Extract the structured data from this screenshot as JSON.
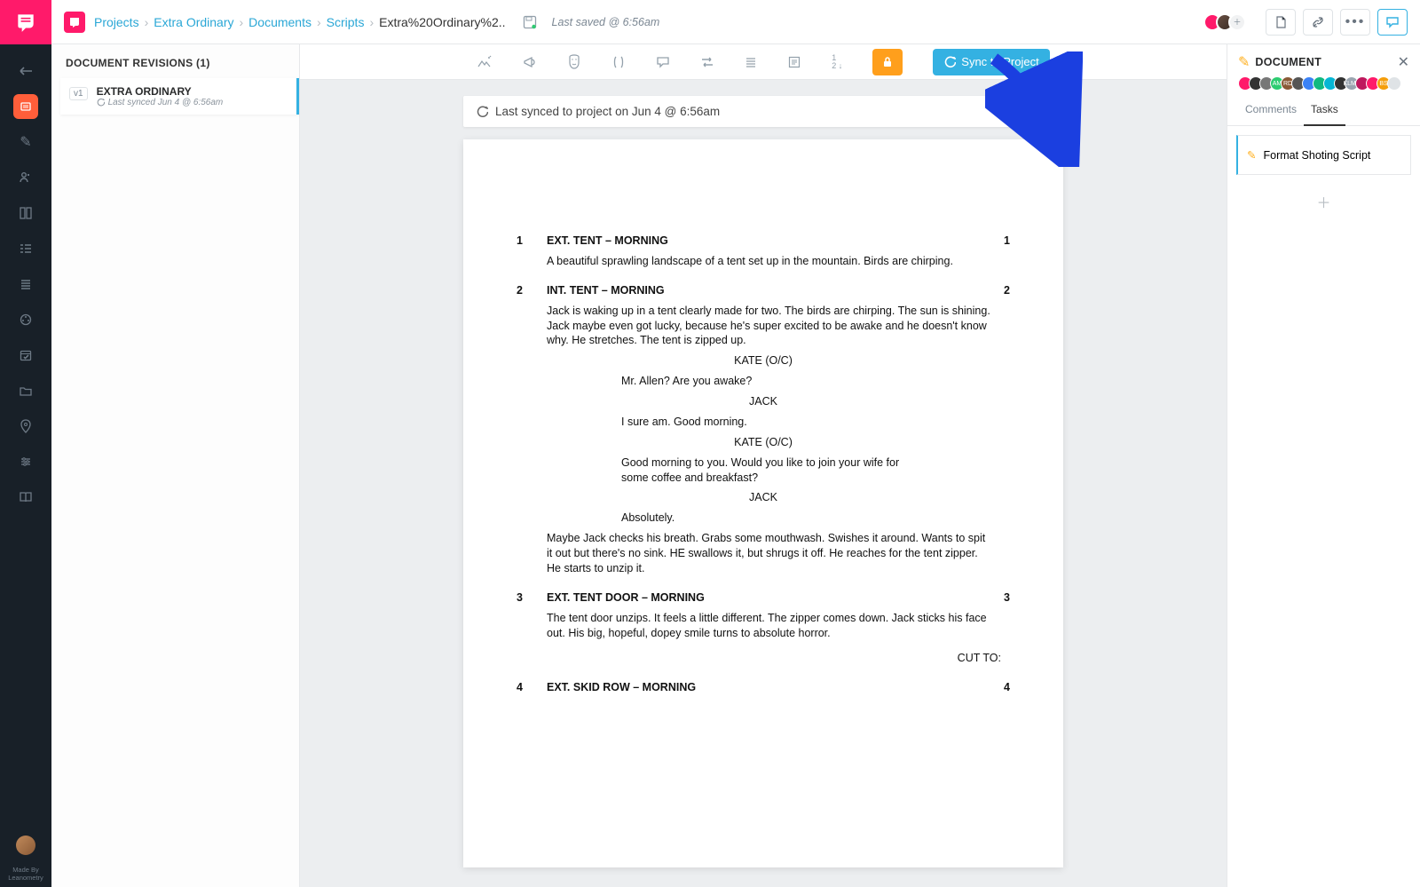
{
  "breadcrumbs": {
    "projects": "Projects",
    "project": "Extra Ordinary",
    "documents": "Documents",
    "scripts": "Scripts",
    "current": "Extra%20Ordinary%2.."
  },
  "topbar": {
    "last_saved": "Last saved @ 6:56am"
  },
  "revisions": {
    "heading": "DOCUMENT REVISIONS (1)",
    "items": [
      {
        "version": "v1",
        "title": "EXTRA ORDINARY",
        "meta": "Last synced Jun 4 @ 6:56am"
      }
    ]
  },
  "toolbar": {
    "sync_label": "Sync to Project"
  },
  "syncbar": {
    "text": "Last synced to project on Jun 4 @ 6:56am"
  },
  "script": {
    "scenes": [
      {
        "num": "1",
        "heading": "EXT. TENT – MORNING",
        "blocks": [
          {
            "type": "action",
            "text": "A beautiful sprawling landscape of a tent set up in the mountain. Birds are chirping."
          }
        ]
      },
      {
        "num": "2",
        "heading": "INT. TENT – MORNING",
        "blocks": [
          {
            "type": "action",
            "text": "Jack is waking up in a tent clearly made for two. The birds are chirping. The sun is shining. Jack maybe even got lucky, because he's super excited to be awake and he doesn't know why. He stretches. The tent is zipped up."
          },
          {
            "type": "cue",
            "text": "KATE (O/C)"
          },
          {
            "type": "line",
            "text": "Mr. Allen? Are you awake?"
          },
          {
            "type": "cue",
            "text": "JACK"
          },
          {
            "type": "line",
            "text": "I sure am. Good morning."
          },
          {
            "type": "cue",
            "text": "KATE (O/C)"
          },
          {
            "type": "line",
            "text": "Good morning to you. Would you like to join your wife for some coffee and breakfast?"
          },
          {
            "type": "cue",
            "text": "JACK"
          },
          {
            "type": "line",
            "text": "Absolutely."
          },
          {
            "type": "action",
            "text": "Maybe Jack checks his breath. Grabs some mouthwash. Swishes it around. Wants to spit it out but there's no sink. HE swallows it, but shrugs it off. He reaches for the tent zipper. He starts to unzip it."
          }
        ]
      },
      {
        "num": "3",
        "heading": "EXT. TENT DOOR – MORNING",
        "blocks": [
          {
            "type": "action",
            "text": "The tent door unzips. It feels a little different. The zipper comes down. Jack sticks his face out. His big, hopeful, dopey smile turns to absolute horror."
          },
          {
            "type": "transition",
            "text": "CUT TO:"
          }
        ]
      },
      {
        "num": "4",
        "heading": "EXT. SKID ROW – MORNING",
        "blocks": []
      }
    ]
  },
  "side": {
    "title": "DOCUMENT",
    "tabs": {
      "comments": "Comments",
      "tasks": "Tasks"
    },
    "task_input": "Format Shoting Script"
  },
  "footer": {
    "made_by": "Made By",
    "leanometry": "Leanometry"
  },
  "avatars": {
    "top": [
      "#ff1a6a",
      "#6a5043",
      "#dfe3e6"
    ],
    "side": [
      {
        "c": "#ff1a6a",
        "t": ""
      },
      {
        "c": "#333",
        "t": ""
      },
      {
        "c": "#777",
        "t": ""
      },
      {
        "c": "#2ecc71",
        "t": "AM"
      },
      {
        "c": "#8a5a36",
        "t": "RD"
      },
      {
        "c": "#555",
        "t": ""
      },
      {
        "c": "#3b82f6",
        "t": ""
      },
      {
        "c": "#10b981",
        "t": ""
      },
      {
        "c": "#06b6d4",
        "t": ""
      },
      {
        "c": "#333",
        "t": ""
      },
      {
        "c": "#9aa5b0",
        "t": "KLMV"
      },
      {
        "c": "#be185d",
        "t": ""
      },
      {
        "c": "#ff1a6a",
        "t": ""
      },
      {
        "c": "#f59e0b",
        "t": "BS"
      },
      {
        "c": "#dfe3e6",
        "t": ""
      }
    ]
  }
}
